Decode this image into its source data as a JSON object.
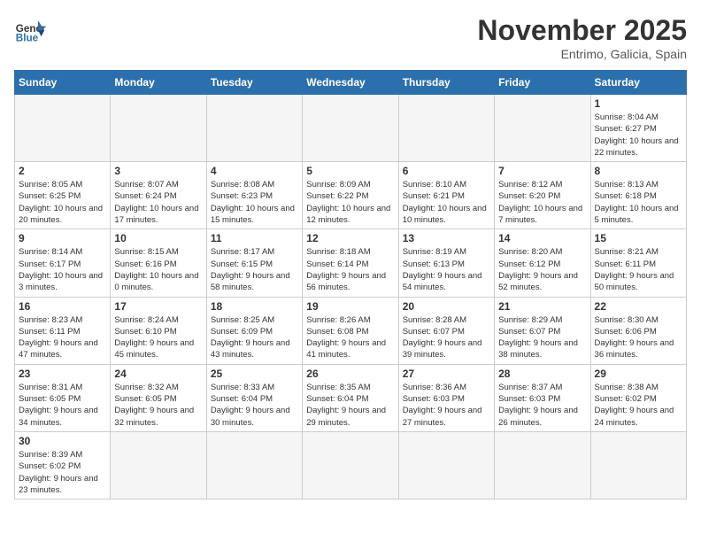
{
  "header": {
    "logo_general": "General",
    "logo_blue": "Blue",
    "month_title": "November 2025",
    "location": "Entrimo, Galicia, Spain"
  },
  "days_of_week": [
    "Sunday",
    "Monday",
    "Tuesday",
    "Wednesday",
    "Thursday",
    "Friday",
    "Saturday"
  ],
  "weeks": [
    [
      {
        "day": "",
        "info": ""
      },
      {
        "day": "",
        "info": ""
      },
      {
        "day": "",
        "info": ""
      },
      {
        "day": "",
        "info": ""
      },
      {
        "day": "",
        "info": ""
      },
      {
        "day": "",
        "info": ""
      },
      {
        "day": "1",
        "info": "Sunrise: 8:04 AM\nSunset: 6:27 PM\nDaylight: 10 hours and 22 minutes."
      }
    ],
    [
      {
        "day": "2",
        "info": "Sunrise: 8:05 AM\nSunset: 6:25 PM\nDaylight: 10 hours and 20 minutes."
      },
      {
        "day": "3",
        "info": "Sunrise: 8:07 AM\nSunset: 6:24 PM\nDaylight: 10 hours and 17 minutes."
      },
      {
        "day": "4",
        "info": "Sunrise: 8:08 AM\nSunset: 6:23 PM\nDaylight: 10 hours and 15 minutes."
      },
      {
        "day": "5",
        "info": "Sunrise: 8:09 AM\nSunset: 6:22 PM\nDaylight: 10 hours and 12 minutes."
      },
      {
        "day": "6",
        "info": "Sunrise: 8:10 AM\nSunset: 6:21 PM\nDaylight: 10 hours and 10 minutes."
      },
      {
        "day": "7",
        "info": "Sunrise: 8:12 AM\nSunset: 6:20 PM\nDaylight: 10 hours and 7 minutes."
      },
      {
        "day": "8",
        "info": "Sunrise: 8:13 AM\nSunset: 6:18 PM\nDaylight: 10 hours and 5 minutes."
      }
    ],
    [
      {
        "day": "9",
        "info": "Sunrise: 8:14 AM\nSunset: 6:17 PM\nDaylight: 10 hours and 3 minutes."
      },
      {
        "day": "10",
        "info": "Sunrise: 8:15 AM\nSunset: 6:16 PM\nDaylight: 10 hours and 0 minutes."
      },
      {
        "day": "11",
        "info": "Sunrise: 8:17 AM\nSunset: 6:15 PM\nDaylight: 9 hours and 58 minutes."
      },
      {
        "day": "12",
        "info": "Sunrise: 8:18 AM\nSunset: 6:14 PM\nDaylight: 9 hours and 56 minutes."
      },
      {
        "day": "13",
        "info": "Sunrise: 8:19 AM\nSunset: 6:13 PM\nDaylight: 9 hours and 54 minutes."
      },
      {
        "day": "14",
        "info": "Sunrise: 8:20 AM\nSunset: 6:12 PM\nDaylight: 9 hours and 52 minutes."
      },
      {
        "day": "15",
        "info": "Sunrise: 8:21 AM\nSunset: 6:11 PM\nDaylight: 9 hours and 50 minutes."
      }
    ],
    [
      {
        "day": "16",
        "info": "Sunrise: 8:23 AM\nSunset: 6:11 PM\nDaylight: 9 hours and 47 minutes."
      },
      {
        "day": "17",
        "info": "Sunrise: 8:24 AM\nSunset: 6:10 PM\nDaylight: 9 hours and 45 minutes."
      },
      {
        "day": "18",
        "info": "Sunrise: 8:25 AM\nSunset: 6:09 PM\nDaylight: 9 hours and 43 minutes."
      },
      {
        "day": "19",
        "info": "Sunrise: 8:26 AM\nSunset: 6:08 PM\nDaylight: 9 hours and 41 minutes."
      },
      {
        "day": "20",
        "info": "Sunrise: 8:28 AM\nSunset: 6:07 PM\nDaylight: 9 hours and 39 minutes."
      },
      {
        "day": "21",
        "info": "Sunrise: 8:29 AM\nSunset: 6:07 PM\nDaylight: 9 hours and 38 minutes."
      },
      {
        "day": "22",
        "info": "Sunrise: 8:30 AM\nSunset: 6:06 PM\nDaylight: 9 hours and 36 minutes."
      }
    ],
    [
      {
        "day": "23",
        "info": "Sunrise: 8:31 AM\nSunset: 6:05 PM\nDaylight: 9 hours and 34 minutes."
      },
      {
        "day": "24",
        "info": "Sunrise: 8:32 AM\nSunset: 6:05 PM\nDaylight: 9 hours and 32 minutes."
      },
      {
        "day": "25",
        "info": "Sunrise: 8:33 AM\nSunset: 6:04 PM\nDaylight: 9 hours and 30 minutes."
      },
      {
        "day": "26",
        "info": "Sunrise: 8:35 AM\nSunset: 6:04 PM\nDaylight: 9 hours and 29 minutes."
      },
      {
        "day": "27",
        "info": "Sunrise: 8:36 AM\nSunset: 6:03 PM\nDaylight: 9 hours and 27 minutes."
      },
      {
        "day": "28",
        "info": "Sunrise: 8:37 AM\nSunset: 6:03 PM\nDaylight: 9 hours and 26 minutes."
      },
      {
        "day": "29",
        "info": "Sunrise: 8:38 AM\nSunset: 6:02 PM\nDaylight: 9 hours and 24 minutes."
      }
    ],
    [
      {
        "day": "30",
        "info": "Sunrise: 8:39 AM\nSunset: 6:02 PM\nDaylight: 9 hours and 23 minutes."
      },
      {
        "day": "",
        "info": ""
      },
      {
        "day": "",
        "info": ""
      },
      {
        "day": "",
        "info": ""
      },
      {
        "day": "",
        "info": ""
      },
      {
        "day": "",
        "info": ""
      },
      {
        "day": "",
        "info": ""
      }
    ]
  ]
}
